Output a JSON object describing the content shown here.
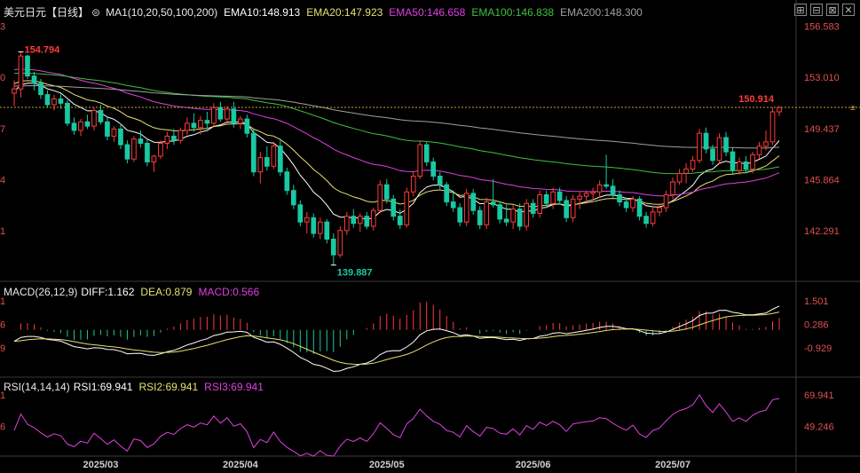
{
  "instrument": {
    "title": "美元日元【日线】",
    "ma_label": "MA1(10,20,50,100,200)",
    "ema10": "EMA10:148.913",
    "ema20": "EMA20:147.923",
    "ema50": "EMA50:146.658",
    "ema100": "EMA100:146.838",
    "ema200": "EMA200:148.300"
  },
  "macd_legend": {
    "name": "MACD(26,12,9)",
    "diff": "DIFF:1.162",
    "dea": "DEA:0.879",
    "macd": "MACD:0.566"
  },
  "rsi_legend": {
    "name": "RSI(14,14,14)",
    "rsi1": "RSI1:69.941",
    "rsi2": "RSI2:69.941",
    "rsi3": "RSI3:69.941"
  },
  "toolbar": {
    "buttons": [
      "⊞",
      "⊟",
      "⊠",
      "✕"
    ],
    "right_marker": "≡"
  },
  "colors": {
    "up": "#ff3b3b",
    "down": "#19c9a3",
    "ema10": "#ffffff",
    "ema20": "#e8e070",
    "ema50": "#e040e0",
    "ema100": "#40c040",
    "ema200": "#a0a0a0",
    "rsi": "#e040e0",
    "price_line": "#c9a040"
  },
  "chart_data": {
    "type": "candlestick",
    "main_panel": {
      "y_ticks": [
        "156.583",
        "153.010",
        "149.437",
        "145.864",
        "142.291"
      ],
      "y_tick_values": [
        156.583,
        153.01,
        149.437,
        145.864,
        142.291
      ],
      "ylim": [
        139.0,
        157.3
      ],
      "left_cut_labels": [
        "3",
        "0",
        "7",
        "4",
        "1"
      ],
      "annotations": {
        "high": "154.794",
        "low": "139.887",
        "last": "150.914"
      },
      "high_value": 154.794,
      "low_value": 139.887,
      "last_value": 150.914,
      "candles": [
        [
          151.9,
          152.8,
          151.0,
          152.2
        ],
        [
          152.2,
          154.79,
          151.6,
          154.5
        ],
        [
          154.5,
          154.6,
          152.9,
          153.1
        ],
        [
          153.1,
          153.4,
          152.1,
          152.6
        ],
        [
          152.6,
          152.9,
          151.5,
          151.8
        ],
        [
          151.8,
          152.1,
          150.9,
          151.1
        ],
        [
          151.1,
          151.8,
          150.7,
          151.5
        ],
        [
          151.5,
          151.9,
          150.8,
          151.2
        ],
        [
          151.2,
          151.4,
          149.6,
          149.8
        ],
        [
          149.8,
          150.2,
          149.0,
          149.3
        ],
        [
          149.3,
          150.1,
          148.9,
          149.9
        ],
        [
          149.9,
          150.4,
          149.4,
          149.6
        ],
        [
          149.6,
          150.9,
          149.3,
          150.7
        ],
        [
          150.7,
          151.1,
          149.7,
          149.9
        ],
        [
          149.9,
          150.3,
          148.6,
          148.9
        ],
        [
          148.9,
          149.6,
          148.5,
          149.4
        ],
        [
          149.4,
          149.8,
          148.0,
          148.3
        ],
        [
          148.3,
          148.6,
          147.0,
          147.3
        ],
        [
          147.3,
          148.9,
          147.1,
          148.7
        ],
        [
          148.7,
          149.3,
          148.1,
          148.4
        ],
        [
          148.4,
          148.7,
          146.8,
          147.1
        ],
        [
          147.1,
          147.6,
          146.4,
          147.5
        ],
        [
          147.5,
          148.6,
          147.3,
          148.4
        ],
        [
          148.4,
          149.2,
          148.0,
          148.9
        ],
        [
          148.9,
          149.4,
          148.3,
          148.6
        ],
        [
          148.6,
          149.5,
          148.4,
          149.3
        ],
        [
          149.3,
          150.2,
          149.0,
          149.8
        ],
        [
          149.8,
          150.5,
          149.2,
          149.5
        ],
        [
          149.5,
          150.3,
          149.0,
          150.0
        ],
        [
          150.0,
          150.6,
          149.4,
          149.8
        ],
        [
          149.8,
          151.2,
          149.6,
          150.9
        ],
        [
          150.9,
          151.3,
          149.9,
          150.1
        ],
        [
          150.1,
          151.0,
          149.8,
          150.8
        ],
        [
          150.8,
          151.3,
          149.5,
          149.8
        ],
        [
          149.8,
          150.3,
          149.4,
          150.1
        ],
        [
          150.1,
          150.4,
          148.8,
          149.1
        ],
        [
          149.1,
          149.4,
          146.1,
          146.4
        ],
        [
          146.4,
          147.8,
          145.6,
          147.4
        ],
        [
          147.4,
          148.2,
          146.5,
          146.8
        ],
        [
          146.8,
          148.5,
          146.6,
          148.2
        ],
        [
          148.2,
          148.6,
          146.1,
          146.4
        ],
        [
          146.4,
          146.7,
          144.8,
          145.1
        ],
        [
          145.1,
          145.5,
          143.8,
          144.1
        ],
        [
          144.1,
          144.4,
          142.6,
          142.9
        ],
        [
          142.9,
          143.6,
          142.1,
          143.2
        ],
        [
          143.2,
          143.5,
          141.8,
          142.1
        ],
        [
          142.1,
          143.2,
          141.7,
          142.9
        ],
        [
          142.9,
          143.1,
          141.4,
          141.7
        ],
        [
          141.7,
          142.1,
          139.887,
          140.6
        ],
        [
          140.6,
          142.6,
          140.4,
          142.3
        ],
        [
          142.3,
          143.6,
          142.0,
          143.3
        ],
        [
          143.3,
          143.8,
          142.5,
          142.8
        ],
        [
          142.8,
          143.5,
          142.2,
          143.3
        ],
        [
          143.3,
          143.6,
          142.4,
          142.6
        ],
        [
          142.6,
          143.9,
          142.3,
          143.7
        ],
        [
          143.7,
          145.8,
          143.5,
          145.5
        ],
        [
          145.5,
          145.9,
          144.2,
          144.5
        ],
        [
          144.5,
          144.8,
          143.0,
          143.3
        ],
        [
          143.3,
          143.8,
          142.4,
          142.7
        ],
        [
          142.7,
          145.3,
          142.5,
          145.0
        ],
        [
          145.0,
          146.4,
          144.7,
          146.1
        ],
        [
          146.1,
          148.6,
          145.9,
          148.3
        ],
        [
          148.3,
          148.5,
          146.8,
          147.1
        ],
        [
          147.1,
          147.4,
          145.8,
          146.1
        ],
        [
          146.1,
          146.4,
          145.2,
          145.5
        ],
        [
          145.5,
          145.7,
          144.0,
          144.3
        ],
        [
          144.3,
          145.1,
          143.6,
          143.9
        ],
        [
          143.9,
          144.2,
          142.6,
          142.9
        ],
        [
          142.9,
          145.2,
          142.6,
          144.9
        ],
        [
          144.9,
          145.2,
          143.4,
          143.7
        ],
        [
          143.7,
          144.0,
          142.4,
          142.7
        ],
        [
          142.7,
          144.6,
          142.4,
          144.3
        ],
        [
          144.3,
          145.9,
          143.9,
          144.1
        ],
        [
          144.1,
          144.3,
          142.8,
          143.1
        ],
        [
          143.1,
          144.1,
          142.6,
          142.9
        ],
        [
          142.9,
          144.1,
          142.4,
          143.8
        ],
        [
          143.8,
          144.2,
          142.3,
          142.6
        ],
        [
          142.6,
          144.5,
          142.3,
          144.2
        ],
        [
          144.2,
          144.5,
          143.2,
          143.5
        ],
        [
          143.5,
          145.1,
          143.2,
          144.8
        ],
        [
          144.8,
          145.1,
          143.9,
          144.2
        ],
        [
          144.2,
          145.3,
          143.8,
          145.0
        ],
        [
          145.0,
          145.3,
          144.1,
          144.4
        ],
        [
          144.4,
          144.7,
          142.9,
          143.2
        ],
        [
          143.2,
          144.8,
          142.9,
          144.5
        ],
        [
          144.5,
          145.0,
          143.8,
          144.7
        ],
        [
          144.7,
          145.1,
          144.3,
          144.9
        ],
        [
          144.9,
          145.3,
          144.4,
          145.0
        ],
        [
          145.0,
          145.8,
          144.6,
          145.5
        ],
        [
          145.5,
          147.6,
          145.2,
          145.4
        ],
        [
          145.4,
          145.9,
          144.6,
          144.8
        ],
        [
          144.8,
          145.1,
          144.0,
          144.3
        ],
        [
          144.3,
          144.6,
          143.6,
          143.9
        ],
        [
          143.9,
          144.7,
          143.6,
          144.5
        ],
        [
          144.5,
          144.7,
          143.0,
          143.3
        ],
        [
          143.3,
          143.6,
          142.5,
          142.8
        ],
        [
          142.8,
          143.9,
          142.6,
          143.6
        ],
        [
          143.6,
          144.2,
          143.3,
          143.9
        ],
        [
          143.9,
          145.1,
          143.6,
          144.8
        ],
        [
          144.8,
          146.0,
          144.5,
          145.7
        ],
        [
          145.7,
          146.6,
          145.5,
          146.3
        ],
        [
          146.3,
          147.0,
          145.6,
          146.6
        ],
        [
          146.6,
          147.5,
          146.4,
          147.2
        ],
        [
          147.2,
          149.4,
          147.0,
          149.1
        ],
        [
          149.1,
          149.5,
          147.7,
          148.0
        ],
        [
          148.0,
          148.3,
          146.9,
          147.2
        ],
        [
          147.2,
          149.1,
          147.0,
          148.8
        ],
        [
          148.8,
          149.2,
          147.5,
          147.8
        ],
        [
          147.8,
          148.1,
          146.2,
          146.5
        ],
        [
          146.5,
          147.4,
          146.2,
          147.1
        ],
        [
          147.1,
          147.5,
          146.3,
          146.6
        ],
        [
          146.6,
          147.8,
          146.3,
          147.6
        ],
        [
          147.6,
          148.5,
          147.3,
          148.2
        ],
        [
          148.2,
          149.3,
          147.9,
          148.5
        ],
        [
          148.5,
          150.9,
          148.3,
          150.6
        ],
        [
          150.6,
          151.0,
          150.3,
          150.914
        ]
      ]
    },
    "macd_panel": {
      "y_ticks": [
        "1.501",
        "0.286",
        "-0.929"
      ],
      "y_tick_values": [
        1.501,
        0.286,
        -0.929
      ],
      "left_cut_labels": [
        "1",
        "6",
        "9"
      ],
      "ylim": [
        -2.2,
        1.9
      ]
    },
    "rsi_panel": {
      "y_ticks": [
        "69.941",
        "49.246"
      ],
      "y_tick_values": [
        69.941,
        49.246
      ],
      "left_cut_labels": [
        "1",
        "6"
      ],
      "ylim": [
        30,
        75
      ]
    },
    "x_labels": [
      "2025/03",
      "2025/04",
      "2025/05",
      "2025/06",
      "2025/07"
    ],
    "x_label_indices": [
      13,
      34,
      56,
      78,
      99
    ]
  }
}
